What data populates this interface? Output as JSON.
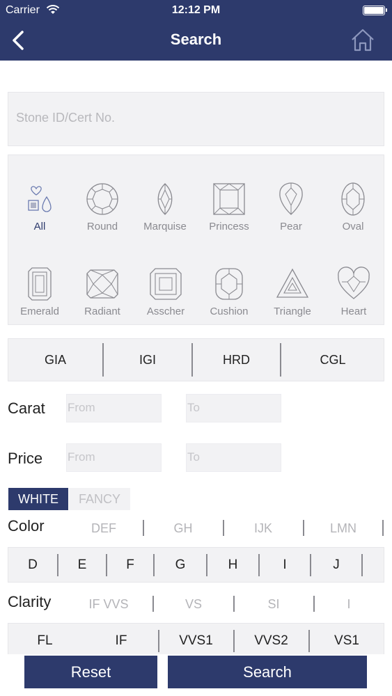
{
  "status_bar": {
    "carrier": "Carrier",
    "time": "12:12 PM"
  },
  "nav": {
    "title": "Search"
  },
  "search": {
    "placeholder": "Stone ID/Cert No."
  },
  "shapes": [
    {
      "label": "All",
      "selected": true
    },
    {
      "label": "Round",
      "selected": false
    },
    {
      "label": "Marquise",
      "selected": false
    },
    {
      "label": "Princess",
      "selected": false
    },
    {
      "label": "Pear",
      "selected": false
    },
    {
      "label": "Oval",
      "selected": false
    },
    {
      "label": "Emerald",
      "selected": false
    },
    {
      "label": "Radiant",
      "selected": false
    },
    {
      "label": "Asscher",
      "selected": false
    },
    {
      "label": "Cushion",
      "selected": false
    },
    {
      "label": "Triangle",
      "selected": false
    },
    {
      "label": "Heart",
      "selected": false
    }
  ],
  "labs": [
    "GIA",
    "IGI",
    "HRD",
    "CGL"
  ],
  "carat": {
    "label": "Carat",
    "from_placeholder": "From",
    "to_placeholder": "To"
  },
  "price": {
    "label": "Price",
    "from_placeholder": "From",
    "to_placeholder": "To"
  },
  "color_type": {
    "white": "WHITE",
    "fancy": "FANCY",
    "selected": "WHITE"
  },
  "color": {
    "label": "Color",
    "groups": [
      "DEF",
      "GH",
      "IJK",
      "LMN"
    ],
    "grades": [
      "D",
      "E",
      "F",
      "G",
      "H",
      "I",
      "J"
    ]
  },
  "clarity": {
    "label": "Clarity",
    "groups": [
      "IF VVS",
      "VS",
      "SI",
      "I"
    ],
    "grades": [
      "FL",
      "IF",
      "VVS1",
      "VVS2",
      "VS1"
    ]
  },
  "footer": {
    "reset": "Reset",
    "search": "Search"
  },
  "colors": {
    "nav_bg": "#2d3a6c",
    "panel_bg": "#f2f2f4",
    "muted_text": "#b4b4b8",
    "icon_stroke": "#8a8a90"
  }
}
